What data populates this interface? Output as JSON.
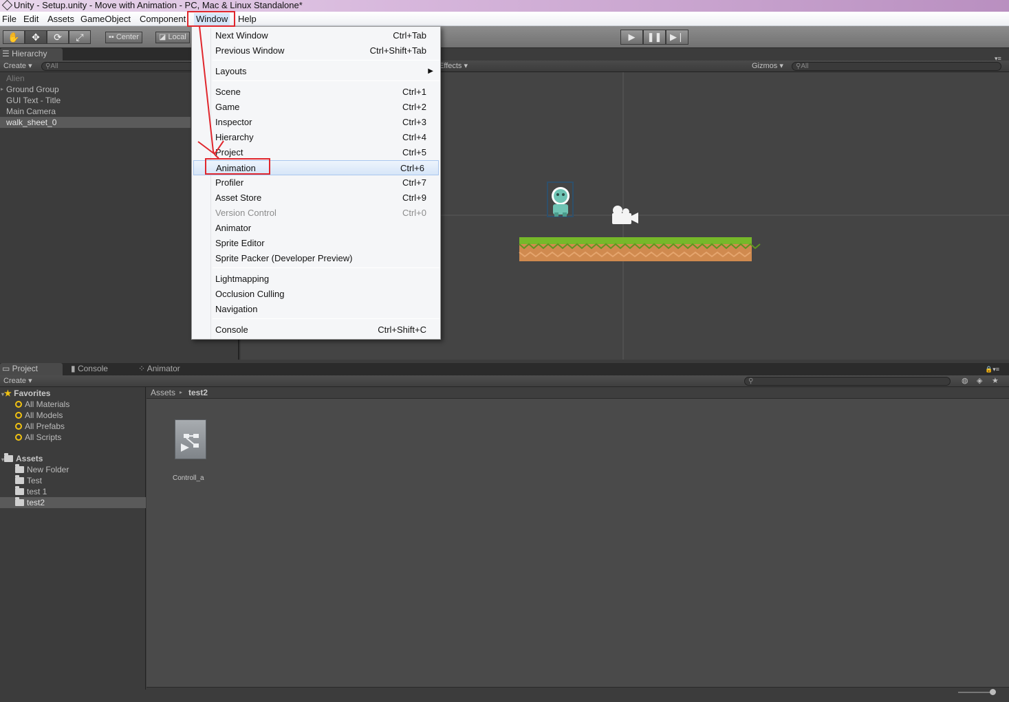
{
  "window": {
    "title": "Unity - Setup.unity - Move with Animation - PC, Mac & Linux Standalone*"
  },
  "menubar": {
    "items": [
      "File",
      "Edit",
      "Assets",
      "GameObject",
      "Component",
      "Window",
      "Help"
    ]
  },
  "toolbar": {
    "pivot_label": "Center",
    "space_label": "Local"
  },
  "hierarchy": {
    "tab_label": "Hierarchy",
    "create_label": "Create",
    "search_placeholder": "All",
    "items": [
      "Alien",
      "Ground Group",
      "GUI Text - Title",
      "Main Camera",
      "walk_sheet_0"
    ]
  },
  "scene": {
    "effects_label": "Effects",
    "gizmos_label": "Gizmos",
    "search_placeholder": "All"
  },
  "window_menu": {
    "items": [
      {
        "label": "Next Window",
        "shortcut": "Ctrl+Tab"
      },
      {
        "label": "Previous Window",
        "shortcut": "Ctrl+Shift+Tab"
      },
      {
        "label": "Layouts",
        "shortcut": ""
      },
      {
        "label": "Scene",
        "shortcut": "Ctrl+1"
      },
      {
        "label": "Game",
        "shortcut": "Ctrl+2"
      },
      {
        "label": "Inspector",
        "shortcut": "Ctrl+3"
      },
      {
        "label": "Hierarchy",
        "shortcut": "Ctrl+4"
      },
      {
        "label": "Project",
        "shortcut": "Ctrl+5"
      },
      {
        "label": "Animation",
        "shortcut": "Ctrl+6"
      },
      {
        "label": "Profiler",
        "shortcut": "Ctrl+7"
      },
      {
        "label": "Asset Store",
        "shortcut": "Ctrl+9"
      },
      {
        "label": "Version Control",
        "shortcut": "Ctrl+0"
      },
      {
        "label": "Animator",
        "shortcut": ""
      },
      {
        "label": "Sprite Editor",
        "shortcut": ""
      },
      {
        "label": "Sprite Packer (Developer Preview)",
        "shortcut": ""
      },
      {
        "label": "Lightmapping",
        "shortcut": ""
      },
      {
        "label": "Occlusion Culling",
        "shortcut": ""
      },
      {
        "label": "Navigation",
        "shortcut": ""
      },
      {
        "label": "Console",
        "shortcut": "Ctrl+Shift+C"
      }
    ]
  },
  "project": {
    "tabs": [
      "Project",
      "Console",
      "Animator"
    ],
    "create_label": "Create",
    "favorites_label": "Favorites",
    "favorites": [
      "All Materials",
      "All Models",
      "All Prefabs",
      "All Scripts"
    ],
    "assets_label": "Assets",
    "folders": [
      "New Folder",
      "Test",
      "test 1",
      "test2"
    ],
    "breadcrumb": [
      "Assets",
      "test2"
    ],
    "asset_items": [
      "Controll_a"
    ]
  },
  "colors": {
    "highlight_red": "#e0262c",
    "menu_highlight": "#d6e5f8"
  }
}
